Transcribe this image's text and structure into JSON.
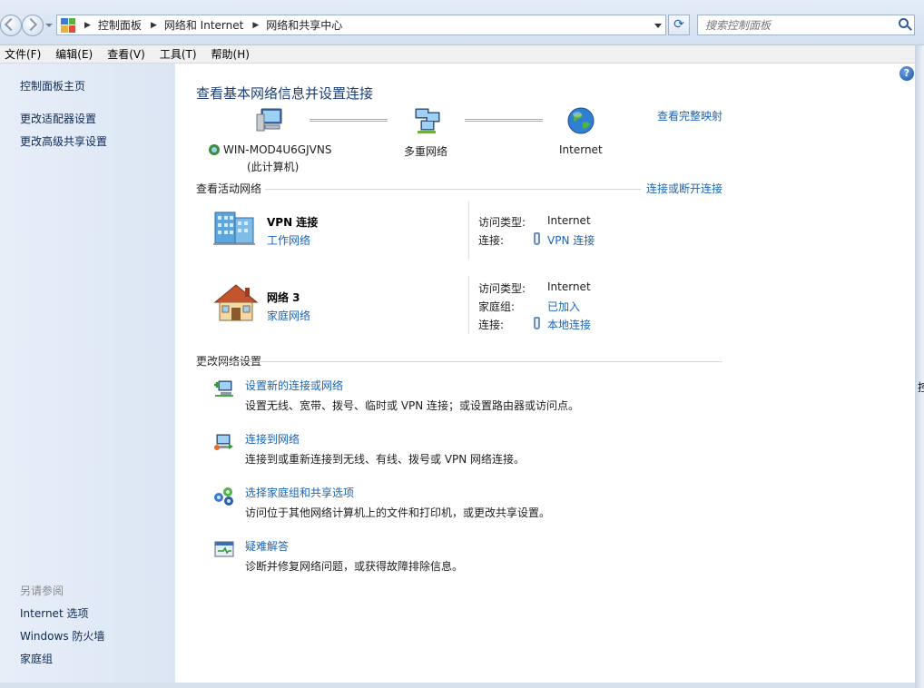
{
  "address_bar": {
    "breadcrumbs": [
      "控制面板",
      "网络和 Internet",
      "网络和共享中心"
    ],
    "search_placeholder": "搜索控制面板"
  },
  "menu": [
    "文件(F)",
    "编辑(E)",
    "查看(V)",
    "工具(T)",
    "帮助(H)"
  ],
  "sidebar": {
    "links": [
      "控制面板主页",
      "更改适配器设置",
      "更改高级共享设置"
    ],
    "see_also_heading": "另请参阅",
    "see_also": [
      "Internet 选项",
      "Windows 防火墙",
      "家庭组"
    ]
  },
  "main": {
    "title": "查看基本网络信息并设置连接",
    "view_full_map": "查看完整映射",
    "map": {
      "computer_name": "WIN-MOD4U6GJVNS",
      "computer_sub": "(此计算机)",
      "middle": "多重网络",
      "right": "Internet"
    },
    "active_heading": "查看活动网络",
    "connect_disconnect": "连接或断开连接",
    "networks": [
      {
        "name": "VPN 连接",
        "type": "工作网络",
        "props": [
          {
            "label": "访问类型:",
            "value": "Internet",
            "is_link": false
          },
          {
            "label": "连接:",
            "value": "VPN 连接",
            "is_link": true
          }
        ]
      },
      {
        "name": "网络  3",
        "type": "家庭网络",
        "props": [
          {
            "label": "访问类型:",
            "value": "Internet",
            "is_link": false
          },
          {
            "label": "家庭组:",
            "value": "已加入",
            "is_link": true
          },
          {
            "label": "连接:",
            "value": "本地连接",
            "is_link": true
          }
        ]
      }
    ],
    "change_heading": "更改网络设置",
    "tasks": [
      {
        "title": "设置新的连接或网络",
        "desc": "设置无线、宽带、拨号、临时或 VPN 连接；或设置路由器或访问点。",
        "icon": "new-connection-icon"
      },
      {
        "title": "连接到网络",
        "desc": "连接到或重新连接到无线、有线、拨号或 VPN 网络连接。",
        "icon": "connect-network-icon"
      },
      {
        "title": "选择家庭组和共享选项",
        "desc": "访问位于其他网络计算机上的文件和打印机，或更改共享设置。",
        "icon": "homegroup-icon"
      },
      {
        "title": "疑难解答",
        "desc": "诊断并修复网络问题，或获得故障排除信息。",
        "icon": "troubleshoot-icon"
      }
    ]
  },
  "right_edge_char": "控",
  "colors": {
    "link": "#1b64b5",
    "title": "#1e3e78",
    "sidebar_bg": "#dbe6f4"
  }
}
